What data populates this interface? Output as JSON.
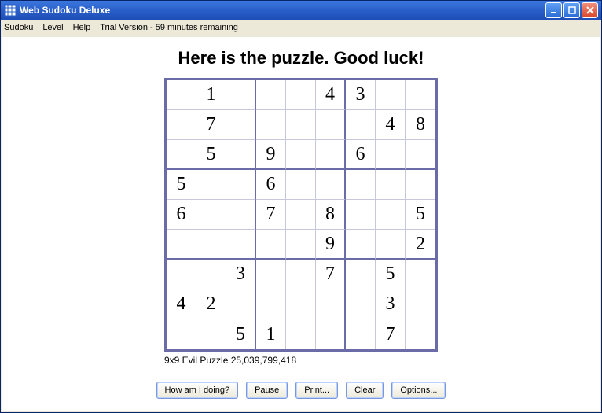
{
  "window": {
    "title": "Web Sudoku Deluxe"
  },
  "menubar": {
    "items": [
      "Sudoku",
      "Level",
      "Help"
    ],
    "trial": "Trial Version - 59 minutes remaining"
  },
  "heading": "Here is the puzzle. Good luck!",
  "puzzle_label": "9x9 Evil Puzzle 25,039,799,418",
  "buttons": {
    "how": "How am I doing?",
    "pause": "Pause",
    "print": "Print...",
    "clear": "Clear",
    "options": "Options..."
  },
  "sudoku": {
    "grid": [
      [
        "",
        "1",
        "",
        "",
        "",
        "4",
        "3",
        "",
        ""
      ],
      [
        "",
        "7",
        "",
        "",
        "",
        "",
        "",
        "4",
        "8"
      ],
      [
        "",
        "5",
        "",
        "9",
        "",
        "",
        "6",
        "",
        ""
      ],
      [
        "5",
        "",
        "",
        "6",
        "",
        "",
        "",
        "",
        ""
      ],
      [
        "6",
        "",
        "",
        "7",
        "",
        "8",
        "",
        "",
        "5"
      ],
      [
        "",
        "",
        "",
        "",
        "",
        "9",
        "",
        "",
        "2"
      ],
      [
        "",
        "",
        "3",
        "",
        "",
        "7",
        "",
        "5",
        ""
      ],
      [
        "4",
        "2",
        "",
        "",
        "",
        "",
        "",
        "3",
        ""
      ],
      [
        "",
        "",
        "5",
        "1",
        "",
        "",
        "",
        "7",
        ""
      ]
    ]
  }
}
